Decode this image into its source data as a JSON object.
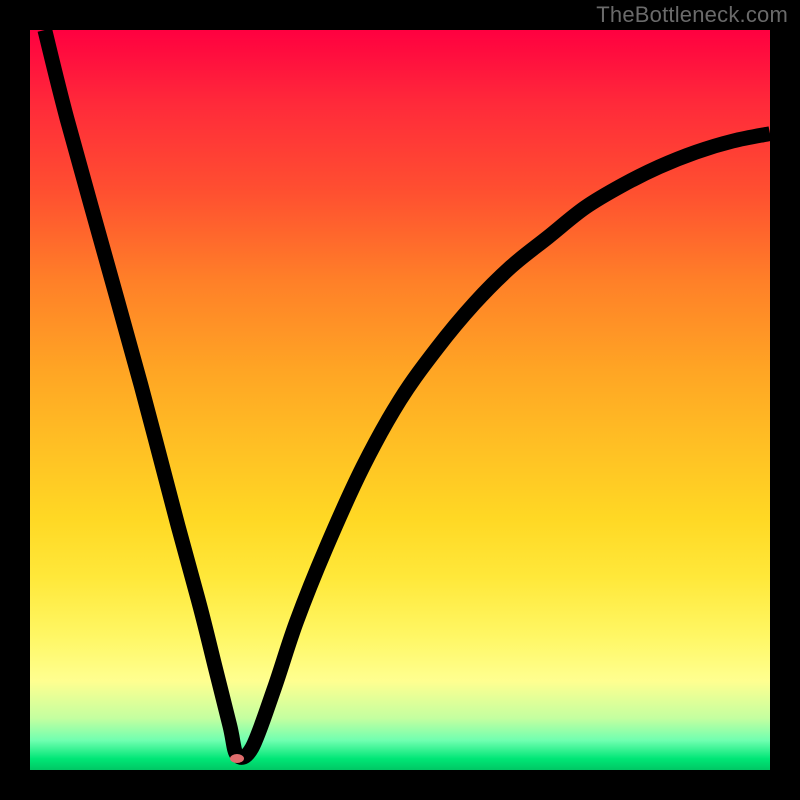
{
  "attribution": "TheBottleneck.com",
  "chart_data": {
    "type": "line",
    "title": "",
    "xlabel": "",
    "ylabel": "",
    "xlim": [
      0,
      100
    ],
    "ylim": [
      0,
      100
    ],
    "gradient_meaning": "y-axis background encodes a heat scale from green (bottom, optimal/low bottleneck) to red (top, severe bottleneck)",
    "series": [
      {
        "name": "bottleneck-curve",
        "x": [
          2,
          5,
          10,
          15,
          20,
          23,
          25,
          27,
          28,
          30,
          33,
          36,
          40,
          45,
          50,
          55,
          60,
          65,
          70,
          75,
          80,
          85,
          90,
          95,
          100
        ],
        "y": [
          100,
          88,
          70,
          52,
          33,
          22,
          14,
          6,
          2,
          3,
          11,
          20,
          30,
          41,
          50,
          57,
          63,
          68,
          72,
          76,
          79,
          81.5,
          83.5,
          85,
          86
        ]
      }
    ],
    "marker": {
      "name": "min-point",
      "x": 28,
      "y": 1.5,
      "color": "#e06d6d"
    },
    "colors": {
      "curve": "#000000",
      "background_frame": "#000000",
      "attribution_text": "#6a6a6a",
      "marker_fill": "#e06d6d"
    }
  }
}
